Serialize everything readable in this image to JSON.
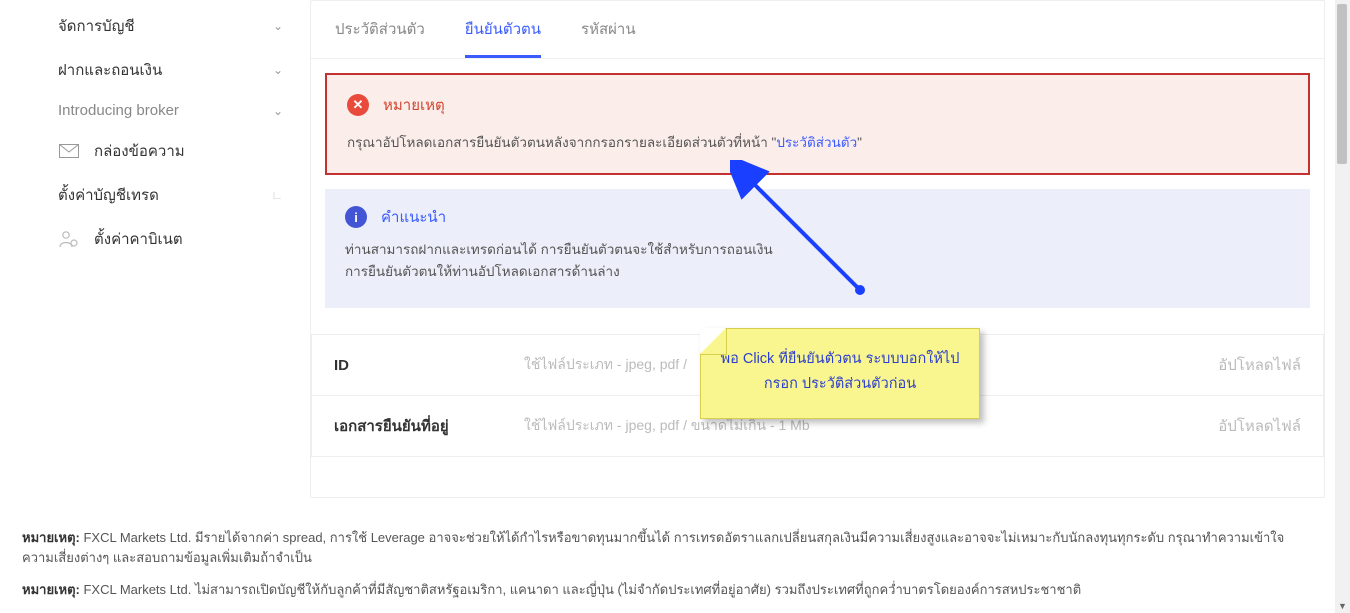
{
  "sidebar": {
    "items": [
      {
        "label": "จัดการบัญชี",
        "hasChevron": true
      },
      {
        "label": "ฝากและถอนเงิน",
        "hasChevron": true
      },
      {
        "label": "Introducing broker",
        "hasChevron": true,
        "light": true
      },
      {
        "label": "กล่องข้อความ",
        "hasChevron": false,
        "icon": "mail"
      },
      {
        "label": "ตั้งค่าบัญชีเทรด",
        "hasChevron": false,
        "corner": true
      },
      {
        "label": "ตั้งค่าคาบิเนต",
        "hasChevron": false,
        "icon": "user-gear"
      }
    ]
  },
  "tabs": [
    {
      "label": "ประวัติส่วนตัว",
      "active": false
    },
    {
      "label": "ยืนยันตัวตน",
      "active": true
    },
    {
      "label": "รหัสผ่าน",
      "active": false
    }
  ],
  "alertError": {
    "title": "หมายเหตุ",
    "bodyPrefix": "กรุณาอัปโหลดเอกสารยืนยันตัวตนหลังจากกรอกรายละเอียดส่วนตัวที่หน้า \"",
    "link": "ประวัติส่วนตัว",
    "bodySuffix": "\""
  },
  "alertInfo": {
    "title": "คำแนะนำ",
    "line1": "ท่านสามารถฝากและเทรดก่อนได้ การยืนยันตัวตนจะใช้สำหรับการถอนเงิน",
    "line2": "การยืนยันตัวตนให้ท่านอัปโหลดเอกสารด้านล่าง"
  },
  "uploads": [
    {
      "label": "ID",
      "hint": "ใช้ไฟล์ประเภท - jpeg, pdf /",
      "action": "อัปโหลดไฟล์"
    },
    {
      "label": "เอกสารยืนยันที่อยู่",
      "hint": "ใช้ไฟล์ประเภท - jpeg, pdf / ขนาดไม่เกิน - 1 Mb",
      "action": "อัปโหลดไฟล์"
    }
  ],
  "sticky": {
    "line1": "พอ Click ที่ยืนยันตัวตน ระบบบอกให้ไป",
    "line2": "กรอก ประวัติส่วนตัวก่อน"
  },
  "footnotes": {
    "label": "หมายเหตุ:",
    "n1_before": " FXCL Markets Ltd. มีรายได้จากค่า spread, การใช้ Leverage อาจจะช่วยให้ได้กำไรหรือขาดทุนมากขึ้นได้ การเทรดอัตราแลกเปลี่ยนสกุลเงินมีความเสี่ยงสูงและอาจจะไม่เหมาะกับนักลงทุนทุกระดับ กรุณาทำความเข้าใจความเสี่ยงต่างๆ และสอบถามข้อมูลเพิ่มเติมถ้าจำเป็น",
    "n2_before": " FXCL Markets Ltd. ไม่สามารถเปิดบัญชีให้กับลูกค้าที่มีสัญชาติสหรัฐอเมริกา, แคนาดา และญี่ปุ่น (ไม่จำกัดประเทศที่อยู่อาศัย) รวมถึงประเทศที่ถูกคว่ำบาตรโดยองค์การสหประชาชาติ"
  }
}
